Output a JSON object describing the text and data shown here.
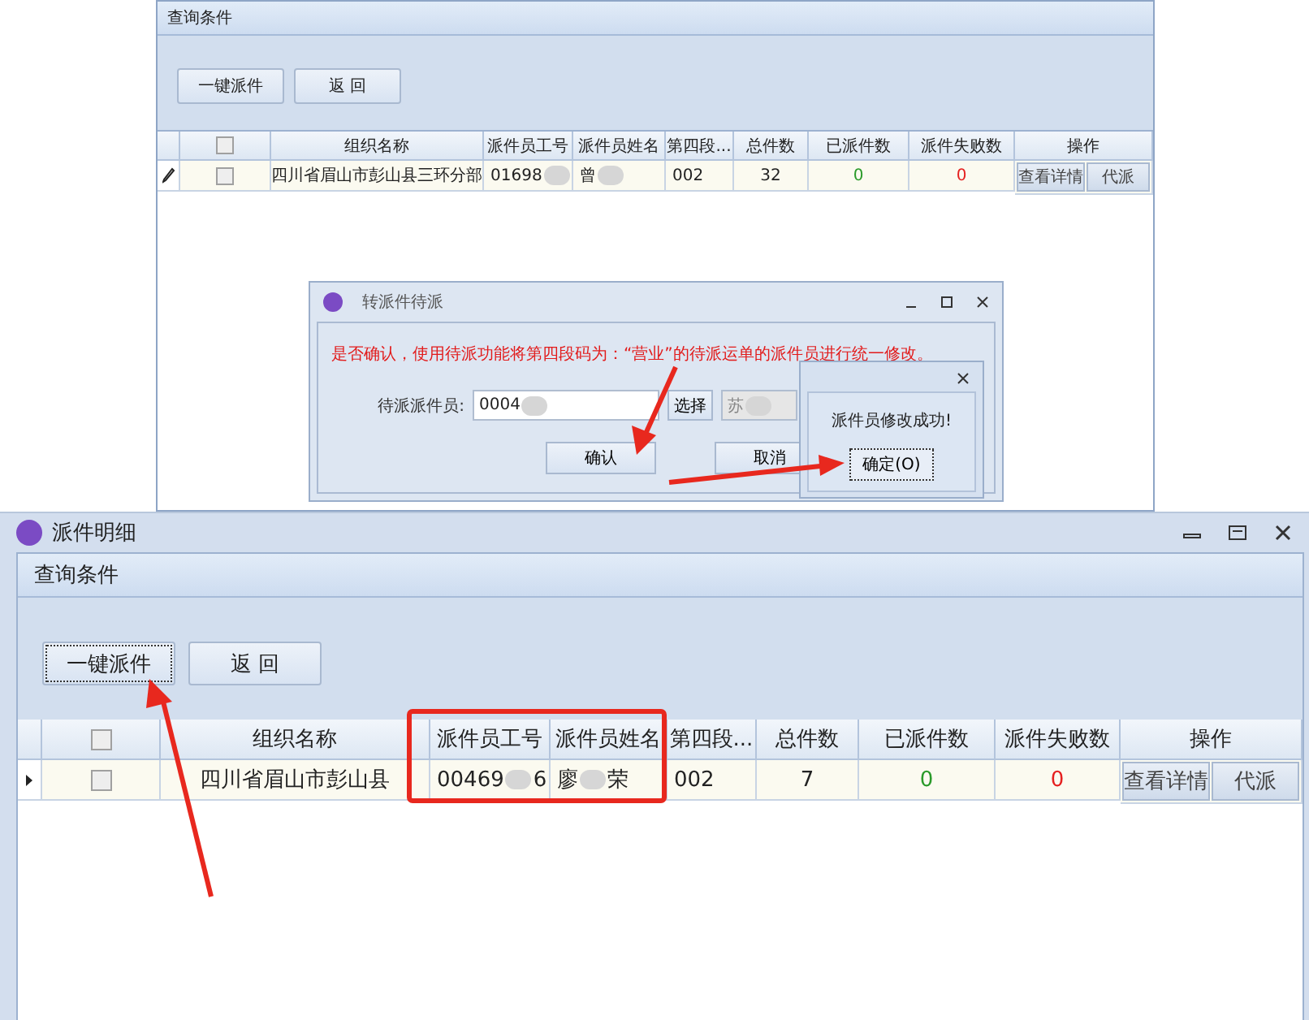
{
  "back_window": {
    "panel_title": "查询条件",
    "buttons": [
      "一键派件",
      "返 回"
    ],
    "columns": [
      "组织名称",
      "派件员工号",
      "派件员姓名",
      "第四段...",
      "总件数",
      "已派件数",
      "派件失败数",
      "操作"
    ],
    "select_all_checked": false,
    "rows": [
      {
        "kind": "editing",
        "checked": false,
        "org": "四川省眉山市彭山县三环分部",
        "emp_id": [
          "01698"
        ],
        "emp_name": [
          "曾"
        ],
        "segment": "002",
        "total": "32",
        "dispatched": "0",
        "failed": "0",
        "actions": [
          "查看详情",
          "代派"
        ]
      }
    ]
  },
  "dialog": {
    "title": "转派件待派",
    "message": "是否确认，使用待派功能将第四段码为：“营业”的待派运单的派件员进行统一修改。",
    "field_label": "待派派件员:",
    "field_value": "0004",
    "select_button": "选择",
    "name_value": "苏",
    "buttons": [
      "确认",
      "取消"
    ]
  },
  "message_box": {
    "message": "派件员修改成功!",
    "button": "确定(O)"
  },
  "main_window": {
    "title": "派件明细",
    "panel_title": "查询条件",
    "buttons": [
      "一键派件",
      "返 回"
    ],
    "columns": [
      "组织名称",
      "派件员工号",
      "派件员姓名",
      "第四段...",
      "总件数",
      "已派件数",
      "派件失败数",
      "操作"
    ],
    "select_all_checked": false,
    "rows": [
      {
        "kind": "current",
        "checked": false,
        "org": "四川省眉山市彭山县",
        "emp_id": [
          "00469",
          "6"
        ],
        "emp_name": [
          "廖",
          "荣"
        ],
        "segment": "002",
        "total": "7",
        "dispatched": "0",
        "failed": "0",
        "actions": [
          "查看详情",
          "代派"
        ]
      }
    ]
  }
}
